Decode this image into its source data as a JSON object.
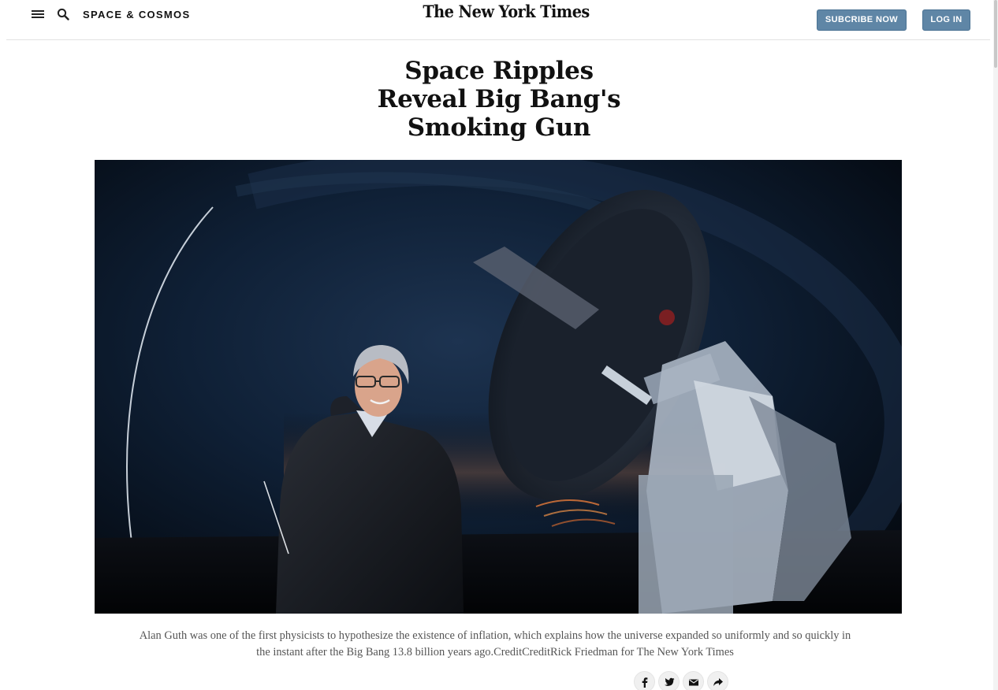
{
  "header": {
    "section": "SPACE & COSMOS",
    "logo": "The New York Times",
    "subscribe_label": "SUBCRIBE NOW",
    "login_label": "LOG IN"
  },
  "article": {
    "headline_lines": [
      "Space Ripples",
      "Reveal Big Bang's",
      "Smoking Gun"
    ],
    "caption": "Alan Guth was one of the first physicists to hypothesize the existence of inflation, which explains how the universe expanded so uniformly and so quickly in the instant after the Big Bang 13.8 billion years ago.CreditCreditRick Friedman for The New York Times"
  },
  "share": {
    "icons": [
      "facebook-icon",
      "twitter-icon",
      "email-icon",
      "share-arrow-icon"
    ]
  },
  "colors": {
    "button_bg": "#5f86a6",
    "caption_text": "#555555",
    "photo_sky": "#0b1a2e"
  }
}
